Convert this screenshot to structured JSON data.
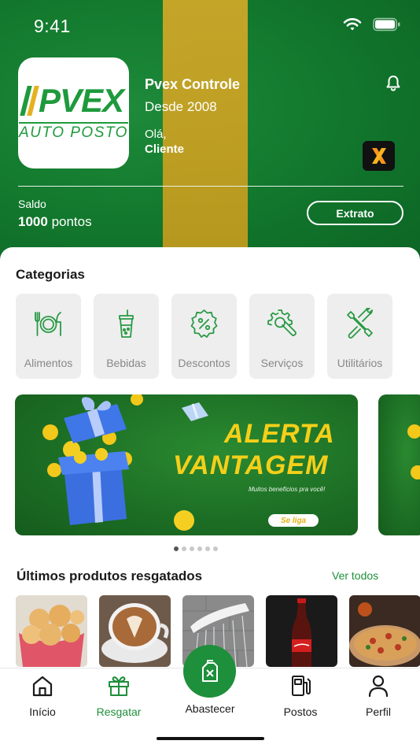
{
  "status_bar": {
    "time": "9:41"
  },
  "header": {
    "logo": {
      "name": "PVEX",
      "subtitle": "AUTO POSTO"
    },
    "brand_title": "Pvex Controle",
    "brand_since": "Desde 2008",
    "greeting": "Olá,",
    "user_name": "Cliente",
    "balance_label": "Saldo",
    "balance_value": "1000",
    "balance_unit": "pontos",
    "statement_button": "Extrato"
  },
  "categories": {
    "title": "Categorias",
    "items": [
      {
        "label": "Alimentos",
        "icon": "plate-cutlery-icon"
      },
      {
        "label": "Bebidas",
        "icon": "drink-cup-icon"
      },
      {
        "label": "Descontos",
        "icon": "discount-badge-icon"
      },
      {
        "label": "Serviços",
        "icon": "gear-wrench-icon"
      },
      {
        "label": "Utilitários",
        "icon": "tools-icon"
      }
    ]
  },
  "banner": {
    "line1": "ALERTA",
    "line2": "VANTAGEM",
    "subtitle": "Muitos benefícios pra você!",
    "cta": "Se liga",
    "page_count": 6,
    "active_page": 0
  },
  "recent": {
    "title": "Últimos produtos resgatados",
    "see_all": "Ver todos",
    "items": [
      {
        "icon": "cheese-bread-image"
      },
      {
        "icon": "latte-coffee-image"
      },
      {
        "icon": "shower-head-image"
      },
      {
        "icon": "coca-cola-bottle-image"
      },
      {
        "icon": "pizza-image"
      }
    ]
  },
  "tabbar": {
    "items": [
      {
        "label": "Início",
        "icon": "home-icon"
      },
      {
        "label": "Resgatar",
        "icon": "gift-icon"
      },
      {
        "label": "Abastecer",
        "icon": "fuel-can-icon"
      },
      {
        "label": "Postos",
        "icon": "fuel-pump-icon"
      },
      {
        "label": "Perfil",
        "icon": "person-icon"
      }
    ],
    "active": "Resgatar"
  },
  "colors": {
    "primary_green": "#1e8f3a",
    "accent_yellow": "#f5cf19",
    "stripe_gold": "#caa021"
  }
}
